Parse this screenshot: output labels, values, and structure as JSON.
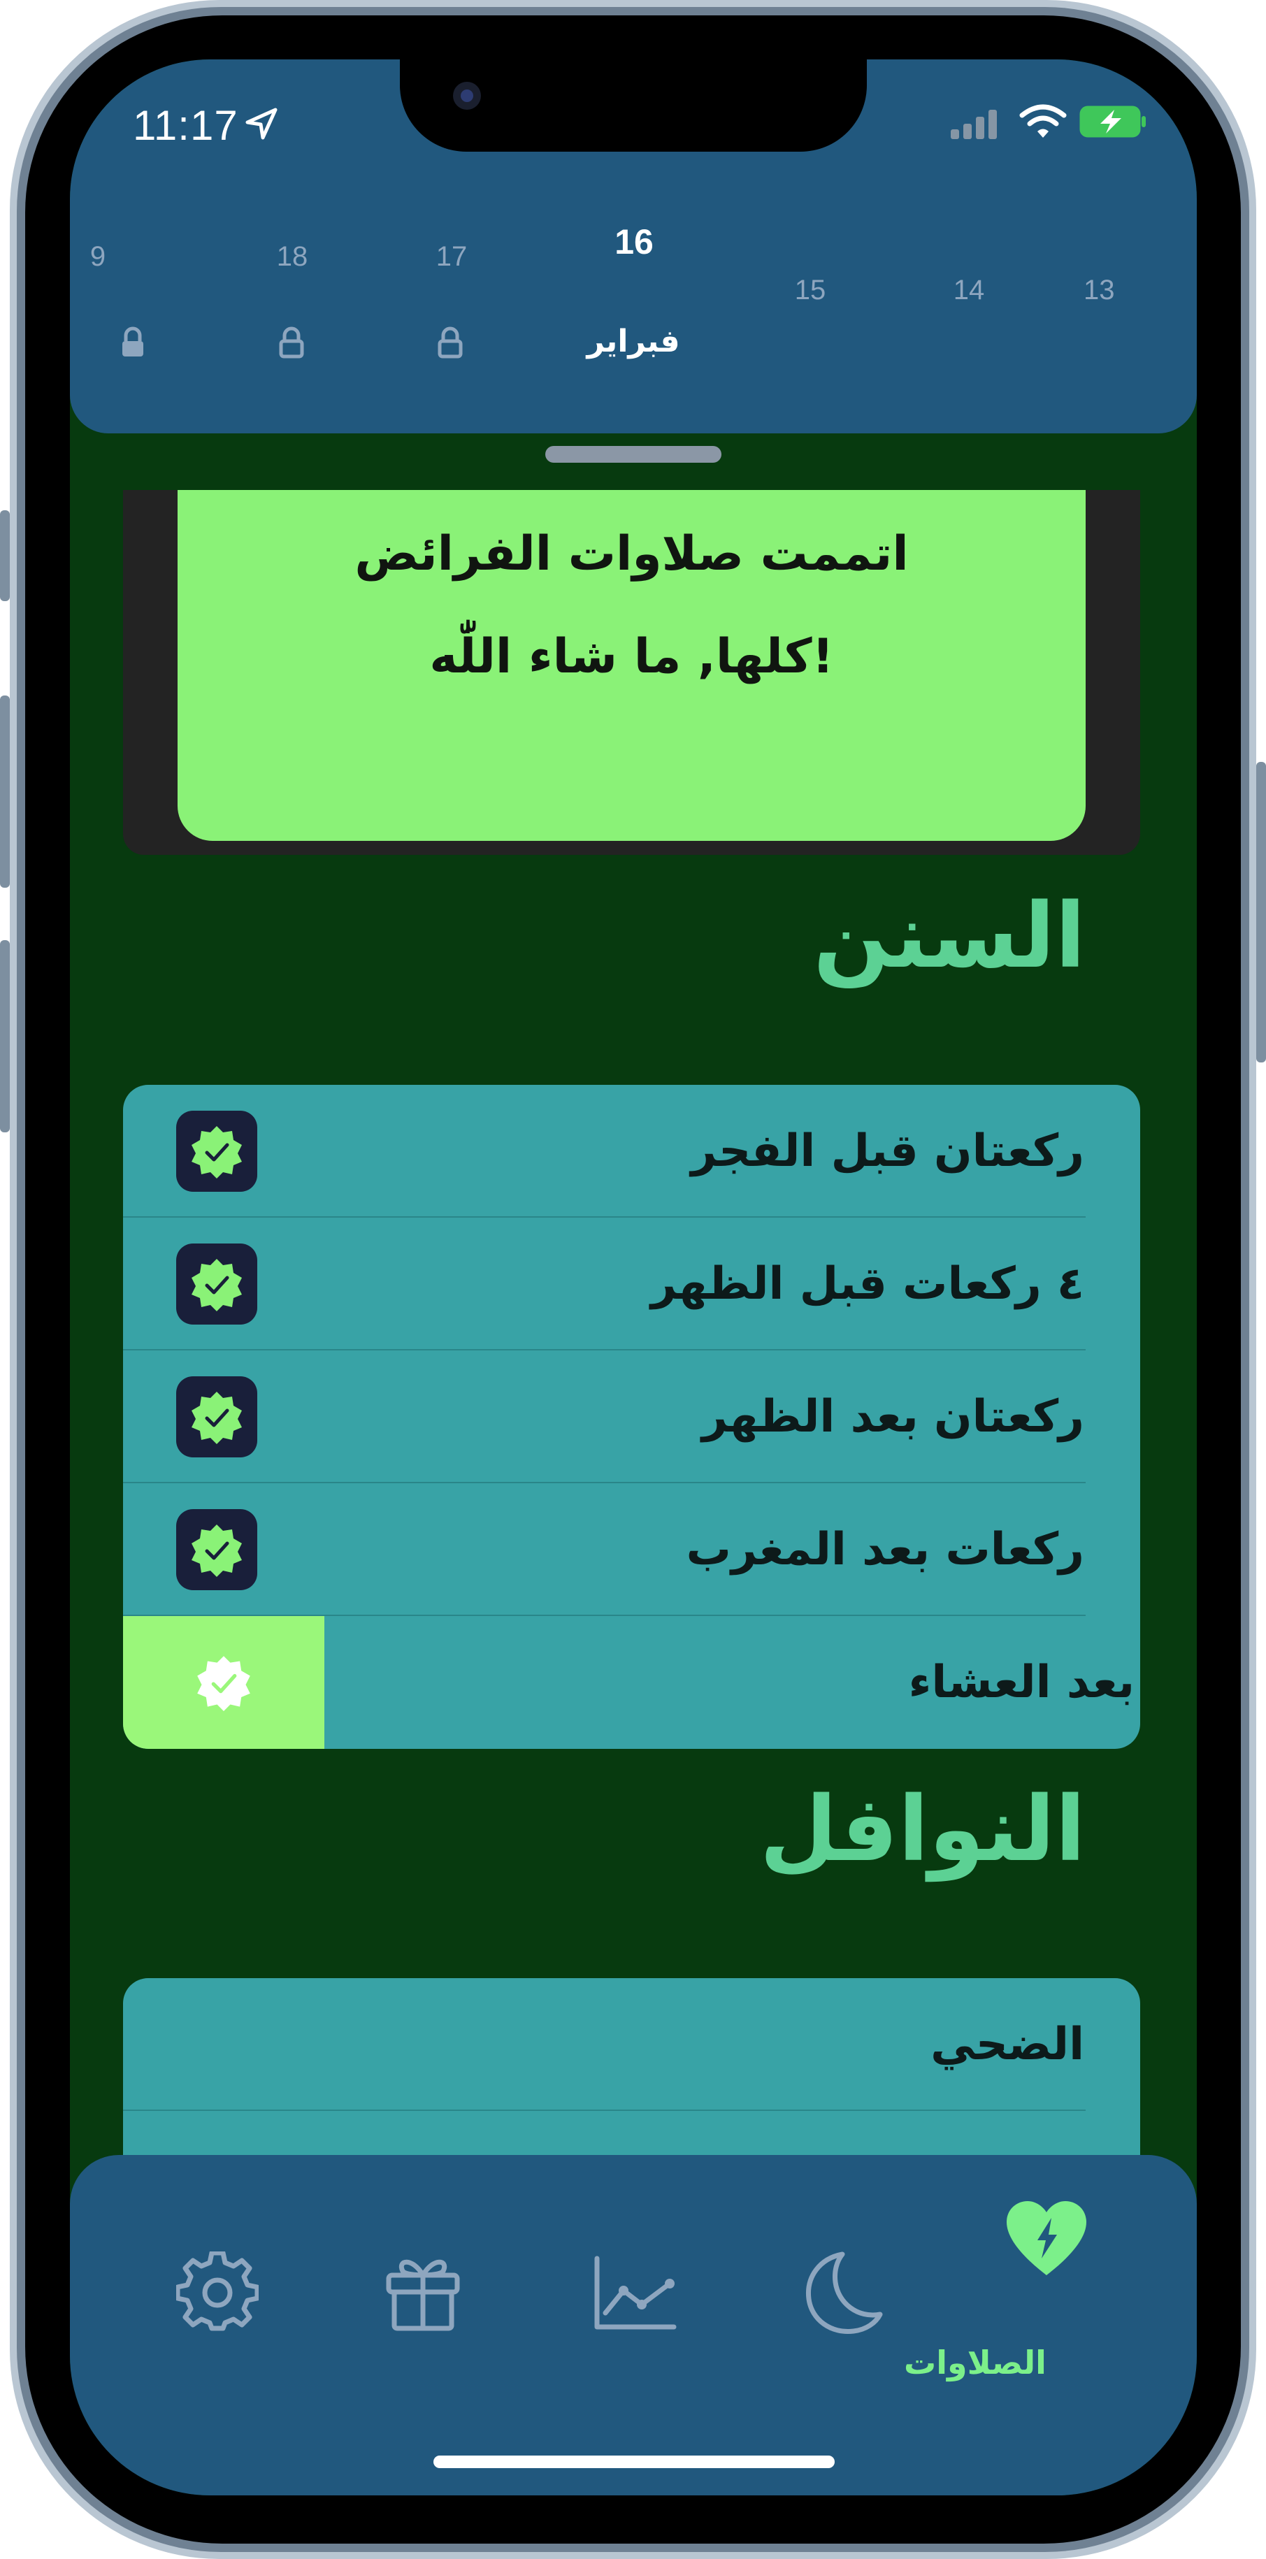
{
  "status_bar": {
    "time": "11:17"
  },
  "date_strip": {
    "days": [
      "9",
      "18",
      "17",
      "15",
      "14",
      "13"
    ],
    "selected_day": "16",
    "selected_month": "فبراير"
  },
  "completion_card": {
    "line1": "اتممت صلاوات الفرائض",
    "line2": "كلها, ما شاء اللّٰه!"
  },
  "sunan": {
    "title": "السنن",
    "items": [
      {
        "label": "ركعتان قبل الفجر",
        "done": true
      },
      {
        "label": "٤ ركعات قبل الظهر",
        "done": true
      },
      {
        "label": "ركعتان بعد الظهر",
        "done": true
      },
      {
        "label": "ركعات بعد المغرب",
        "done": true
      },
      {
        "label": "بعد العشاء",
        "done": true
      }
    ]
  },
  "nawafil": {
    "title": "النوافل",
    "items": [
      {
        "label": "الضحي"
      }
    ]
  },
  "tab_bar": {
    "active_label": "الصلاوات",
    "tabs": [
      "settings-icon",
      "gift-icon",
      "chart-icon",
      "moon-icon",
      "heart-bolt-icon"
    ]
  },
  "colors": {
    "background": "#073a0f",
    "header": "#21587e",
    "accent_green": "#8af277",
    "list_teal": "#38a3a6",
    "title_green": "#5cd194"
  }
}
